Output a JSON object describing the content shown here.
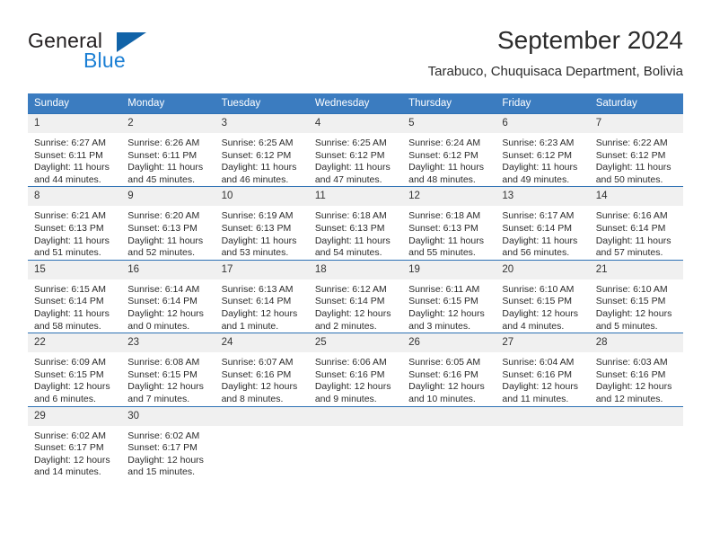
{
  "logo": {
    "line1": "General",
    "line2": "Blue",
    "triangle_color": "#1163a8",
    "blue_text_color": "#1b7fd4"
  },
  "header": {
    "title": "September 2024",
    "subtitle": "Tarabuco, Chuquisaca Department, Bolivia"
  },
  "theme": {
    "header_row_bg": "#3b7cc0",
    "daynum_bg": "#f0f0f0",
    "row_border": "#2e72b5"
  },
  "weekday_headers": [
    "Sunday",
    "Monday",
    "Tuesday",
    "Wednesday",
    "Thursday",
    "Friday",
    "Saturday"
  ],
  "weeks": [
    [
      {
        "day": "1",
        "sunrise": "Sunrise: 6:27 AM",
        "sunset": "Sunset: 6:11 PM",
        "daylight1": "Daylight: 11 hours",
        "daylight2": "and 44 minutes."
      },
      {
        "day": "2",
        "sunrise": "Sunrise: 6:26 AM",
        "sunset": "Sunset: 6:11 PM",
        "daylight1": "Daylight: 11 hours",
        "daylight2": "and 45 minutes."
      },
      {
        "day": "3",
        "sunrise": "Sunrise: 6:25 AM",
        "sunset": "Sunset: 6:12 PM",
        "daylight1": "Daylight: 11 hours",
        "daylight2": "and 46 minutes."
      },
      {
        "day": "4",
        "sunrise": "Sunrise: 6:25 AM",
        "sunset": "Sunset: 6:12 PM",
        "daylight1": "Daylight: 11 hours",
        "daylight2": "and 47 minutes."
      },
      {
        "day": "5",
        "sunrise": "Sunrise: 6:24 AM",
        "sunset": "Sunset: 6:12 PM",
        "daylight1": "Daylight: 11 hours",
        "daylight2": "and 48 minutes."
      },
      {
        "day": "6",
        "sunrise": "Sunrise: 6:23 AM",
        "sunset": "Sunset: 6:12 PM",
        "daylight1": "Daylight: 11 hours",
        "daylight2": "and 49 minutes."
      },
      {
        "day": "7",
        "sunrise": "Sunrise: 6:22 AM",
        "sunset": "Sunset: 6:12 PM",
        "daylight1": "Daylight: 11 hours",
        "daylight2": "and 50 minutes."
      }
    ],
    [
      {
        "day": "8",
        "sunrise": "Sunrise: 6:21 AM",
        "sunset": "Sunset: 6:13 PM",
        "daylight1": "Daylight: 11 hours",
        "daylight2": "and 51 minutes."
      },
      {
        "day": "9",
        "sunrise": "Sunrise: 6:20 AM",
        "sunset": "Sunset: 6:13 PM",
        "daylight1": "Daylight: 11 hours",
        "daylight2": "and 52 minutes."
      },
      {
        "day": "10",
        "sunrise": "Sunrise: 6:19 AM",
        "sunset": "Sunset: 6:13 PM",
        "daylight1": "Daylight: 11 hours",
        "daylight2": "and 53 minutes."
      },
      {
        "day": "11",
        "sunrise": "Sunrise: 6:18 AM",
        "sunset": "Sunset: 6:13 PM",
        "daylight1": "Daylight: 11 hours",
        "daylight2": "and 54 minutes."
      },
      {
        "day": "12",
        "sunrise": "Sunrise: 6:18 AM",
        "sunset": "Sunset: 6:13 PM",
        "daylight1": "Daylight: 11 hours",
        "daylight2": "and 55 minutes."
      },
      {
        "day": "13",
        "sunrise": "Sunrise: 6:17 AM",
        "sunset": "Sunset: 6:14 PM",
        "daylight1": "Daylight: 11 hours",
        "daylight2": "and 56 minutes."
      },
      {
        "day": "14",
        "sunrise": "Sunrise: 6:16 AM",
        "sunset": "Sunset: 6:14 PM",
        "daylight1": "Daylight: 11 hours",
        "daylight2": "and 57 minutes."
      }
    ],
    [
      {
        "day": "15",
        "sunrise": "Sunrise: 6:15 AM",
        "sunset": "Sunset: 6:14 PM",
        "daylight1": "Daylight: 11 hours",
        "daylight2": "and 58 minutes."
      },
      {
        "day": "16",
        "sunrise": "Sunrise: 6:14 AM",
        "sunset": "Sunset: 6:14 PM",
        "daylight1": "Daylight: 12 hours",
        "daylight2": "and 0 minutes."
      },
      {
        "day": "17",
        "sunrise": "Sunrise: 6:13 AM",
        "sunset": "Sunset: 6:14 PM",
        "daylight1": "Daylight: 12 hours",
        "daylight2": "and 1 minute."
      },
      {
        "day": "18",
        "sunrise": "Sunrise: 6:12 AM",
        "sunset": "Sunset: 6:14 PM",
        "daylight1": "Daylight: 12 hours",
        "daylight2": "and 2 minutes."
      },
      {
        "day": "19",
        "sunrise": "Sunrise: 6:11 AM",
        "sunset": "Sunset: 6:15 PM",
        "daylight1": "Daylight: 12 hours",
        "daylight2": "and 3 minutes."
      },
      {
        "day": "20",
        "sunrise": "Sunrise: 6:10 AM",
        "sunset": "Sunset: 6:15 PM",
        "daylight1": "Daylight: 12 hours",
        "daylight2": "and 4 minutes."
      },
      {
        "day": "21",
        "sunrise": "Sunrise: 6:10 AM",
        "sunset": "Sunset: 6:15 PM",
        "daylight1": "Daylight: 12 hours",
        "daylight2": "and 5 minutes."
      }
    ],
    [
      {
        "day": "22",
        "sunrise": "Sunrise: 6:09 AM",
        "sunset": "Sunset: 6:15 PM",
        "daylight1": "Daylight: 12 hours",
        "daylight2": "and 6 minutes."
      },
      {
        "day": "23",
        "sunrise": "Sunrise: 6:08 AM",
        "sunset": "Sunset: 6:15 PM",
        "daylight1": "Daylight: 12 hours",
        "daylight2": "and 7 minutes."
      },
      {
        "day": "24",
        "sunrise": "Sunrise: 6:07 AM",
        "sunset": "Sunset: 6:16 PM",
        "daylight1": "Daylight: 12 hours",
        "daylight2": "and 8 minutes."
      },
      {
        "day": "25",
        "sunrise": "Sunrise: 6:06 AM",
        "sunset": "Sunset: 6:16 PM",
        "daylight1": "Daylight: 12 hours",
        "daylight2": "and 9 minutes."
      },
      {
        "day": "26",
        "sunrise": "Sunrise: 6:05 AM",
        "sunset": "Sunset: 6:16 PM",
        "daylight1": "Daylight: 12 hours",
        "daylight2": "and 10 minutes."
      },
      {
        "day": "27",
        "sunrise": "Sunrise: 6:04 AM",
        "sunset": "Sunset: 6:16 PM",
        "daylight1": "Daylight: 12 hours",
        "daylight2": "and 11 minutes."
      },
      {
        "day": "28",
        "sunrise": "Sunrise: 6:03 AM",
        "sunset": "Sunset: 6:16 PM",
        "daylight1": "Daylight: 12 hours",
        "daylight2": "and 12 minutes."
      }
    ],
    [
      {
        "day": "29",
        "sunrise": "Sunrise: 6:02 AM",
        "sunset": "Sunset: 6:17 PM",
        "daylight1": "Daylight: 12 hours",
        "daylight2": "and 14 minutes."
      },
      {
        "day": "30",
        "sunrise": "Sunrise: 6:02 AM",
        "sunset": "Sunset: 6:17 PM",
        "daylight1": "Daylight: 12 hours",
        "daylight2": "and 15 minutes."
      },
      {
        "day": "",
        "sunrise": "",
        "sunset": "",
        "daylight1": "",
        "daylight2": ""
      },
      {
        "day": "",
        "sunrise": "",
        "sunset": "",
        "daylight1": "",
        "daylight2": ""
      },
      {
        "day": "",
        "sunrise": "",
        "sunset": "",
        "daylight1": "",
        "daylight2": ""
      },
      {
        "day": "",
        "sunrise": "",
        "sunset": "",
        "daylight1": "",
        "daylight2": ""
      },
      {
        "day": "",
        "sunrise": "",
        "sunset": "",
        "daylight1": "",
        "daylight2": ""
      }
    ]
  ]
}
